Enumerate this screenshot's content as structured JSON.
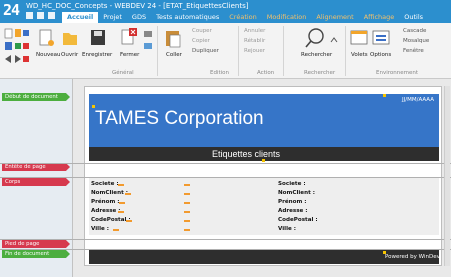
{
  "window": {
    "app_logo": "24",
    "title": "WD_HC_DOC_Concepts - WEBDEV 24 - [ETAT_EtiquettesClients]"
  },
  "menu": {
    "tabs": [
      {
        "label": "Accueil",
        "state": "active"
      },
      {
        "label": "Projet",
        "state": "normal"
      },
      {
        "label": "GDS",
        "state": "normal"
      },
      {
        "label": "Tests automatiques",
        "state": "normal"
      },
      {
        "label": "Création",
        "state": "dim"
      },
      {
        "label": "Modification",
        "state": "dim"
      },
      {
        "label": "Alignement",
        "state": "dim"
      },
      {
        "label": "Affichage",
        "state": "dim"
      },
      {
        "label": "Outils",
        "state": "normal"
      }
    ]
  },
  "ribbon": {
    "general": {
      "nouveau": "Nouveau",
      "ouvrir": "Ouvrir",
      "enregistrer": "Enregistrer",
      "fermer": "Fermer",
      "group": "Général"
    },
    "edition": {
      "coller": "Coller",
      "couper": "Couper",
      "copier": "Copier",
      "dupliquer": "Dupliquer",
      "group": "Edition"
    },
    "action": {
      "annuler": "Annuler",
      "retablir": "Rétablir",
      "rejouer": "Rejouer",
      "group": "Action"
    },
    "rechercher": {
      "label": "Rechercher",
      "group": "Rechercher"
    },
    "environnement": {
      "volets": "Volets",
      "options": "Options",
      "cascade": "Cascade",
      "mosaique": "Mosaïque",
      "fenetre": "Fenêtre",
      "group": "Environnement"
    }
  },
  "bands": {
    "debut_document": "Début de document",
    "entete_page": "Entête de page",
    "corps": "Corps",
    "pied_page": "Pied de page",
    "fin_document": "Fin de document"
  },
  "report": {
    "company": "TAMES Corporation",
    "date_format": "JJ/MM/AAAA",
    "title": "Etiquettes clients",
    "fields": [
      "Societe :",
      "NomClient :",
      "Prénom :",
      "Adresse :",
      "CodePostal :",
      "Ville :"
    ],
    "powered_by": "Powered by WinDev"
  },
  "colors": {
    "titlebar": "#2c8fce",
    "header_band": "#3675c8",
    "dark_band": "#2e2e2e",
    "band_green": "#4cae3f",
    "band_red": "#d6394e",
    "field_marker": "#f29a2e"
  }
}
